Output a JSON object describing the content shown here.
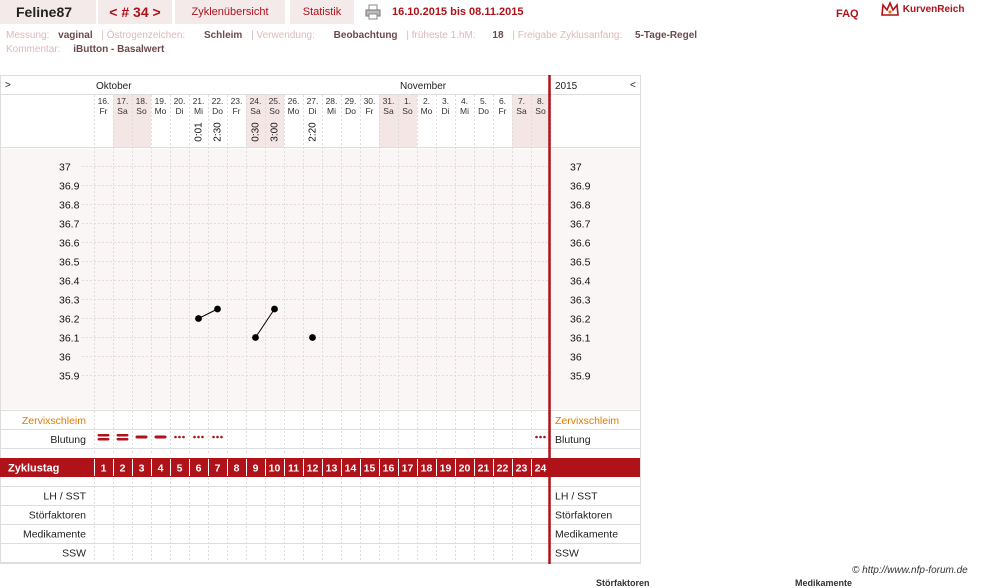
{
  "header": {
    "user": "Feline87",
    "cycle_prev": "<",
    "cycle_label": "# 34",
    "cycle_next": ">",
    "overview_label": "Zyklenübersicht",
    "stats_label": "Statistik",
    "print_icon": "printer-icon",
    "date_range": "16.10.2015 bis 08.11.2015",
    "faq_label": "FAQ",
    "logo_text": "KurvenReich"
  },
  "meta": {
    "messung_key": "Messung:",
    "messung_val": "vaginal",
    "oestrogen_key": "Östrogenzeichen:",
    "oestrogen_val": "Schleim",
    "verwendung_key": "Verwendung:",
    "verwendung_val": "Beobachtung",
    "frueheste_key": "früheste 1.hM:",
    "frueheste_val": "18",
    "freigabe_key": "Freigabe Zyklusanfang:",
    "freigabe_val": "5-Tage-Regel",
    "kommentar_key": "Kommentar:",
    "kommentar_val": "iButton - Basalwert"
  },
  "chart": {
    "nav_left": ">",
    "nav_right": "<",
    "year": "2015",
    "months": [
      {
        "label": "Oktober",
        "first_day_index": 0
      },
      {
        "label": "November",
        "first_day_index": 16
      }
    ],
    "days": [
      {
        "date": "16.",
        "dow": "Fr",
        "time": "",
        "weekend": false
      },
      {
        "date": "17.",
        "dow": "Sa",
        "time": "",
        "weekend": true
      },
      {
        "date": "18.",
        "dow": "So",
        "time": "",
        "weekend": true
      },
      {
        "date": "19.",
        "dow": "Mo",
        "time": "",
        "weekend": false
      },
      {
        "date": "20.",
        "dow": "Di",
        "time": "",
        "weekend": false
      },
      {
        "date": "21.",
        "dow": "Mi",
        "time": "0:01",
        "weekend": false
      },
      {
        "date": "22.",
        "dow": "Do",
        "time": "2:30",
        "weekend": false
      },
      {
        "date": "23.",
        "dow": "Fr",
        "time": "",
        "weekend": false
      },
      {
        "date": "24.",
        "dow": "Sa",
        "time": "0:30",
        "weekend": true
      },
      {
        "date": "25.",
        "dow": "So",
        "time": "3:00",
        "weekend": true
      },
      {
        "date": "26.",
        "dow": "Mo",
        "time": "",
        "weekend": false
      },
      {
        "date": "27.",
        "dow": "Di",
        "time": "2:20",
        "weekend": false
      },
      {
        "date": "28.",
        "dow": "Mi",
        "time": "",
        "weekend": false
      },
      {
        "date": "29.",
        "dow": "Do",
        "time": "",
        "weekend": false
      },
      {
        "date": "30.",
        "dow": "Fr",
        "time": "",
        "weekend": false
      },
      {
        "date": "31.",
        "dow": "Sa",
        "time": "",
        "weekend": true
      },
      {
        "date": "1.",
        "dow": "So",
        "time": "",
        "weekend": true
      },
      {
        "date": "2.",
        "dow": "Mo",
        "time": "",
        "weekend": false
      },
      {
        "date": "3.",
        "dow": "Di",
        "time": "",
        "weekend": false
      },
      {
        "date": "4.",
        "dow": "Mi",
        "time": "",
        "weekend": false
      },
      {
        "date": "5.",
        "dow": "Do",
        "time": "",
        "weekend": false
      },
      {
        "date": "6.",
        "dow": "Fr",
        "time": "",
        "weekend": false
      },
      {
        "date": "7.",
        "dow": "Sa",
        "time": "",
        "weekend": true
      },
      {
        "date": "8.",
        "dow": "So",
        "time": "",
        "weekend": true
      }
    ],
    "temp_ticks": [
      "37",
      "36.9",
      "36.8",
      "36.7",
      "36.6",
      "36.5",
      "36.4",
      "36.3",
      "36.2",
      "36.1",
      "36",
      "35.9"
    ],
    "rows_top": [
      "Zervixschleim",
      "Blutung"
    ],
    "zyklustag_label": "Zyklustag",
    "rows_bottom": [
      "LH / SST",
      "Störfaktoren",
      "Medikamente",
      "SSW"
    ],
    "bleeding": [
      "heavy",
      "heavy",
      "medium",
      "medium",
      "light",
      "light",
      "light",
      "",
      "",
      "",
      "",
      "",
      "",
      "",
      "",
      "",
      "",
      "",
      "",
      "",
      "",
      "",
      "",
      "light"
    ],
    "colors": {
      "accent": "#b0121a",
      "weekend": "#f5e6e6",
      "zervix": "#e07b00"
    }
  },
  "chart_data": {
    "type": "line",
    "title": "",
    "xlabel": "Zyklustag",
    "ylabel": "",
    "ylim": [
      35.9,
      37
    ],
    "x": [
      6,
      7,
      9,
      10,
      12
    ],
    "series": [
      {
        "values": [
          36.2,
          36.25,
          36.1,
          36.25,
          36.1
        ],
        "segments": [
          [
            0,
            1
          ],
          [
            2,
            3
          ]
        ]
      }
    ]
  },
  "footer": {
    "copyright": "© http://www.nfp-forum.de",
    "cut_stoerfaktoren": "Störfaktoren",
    "cut_medikamente": "Medikamente"
  }
}
